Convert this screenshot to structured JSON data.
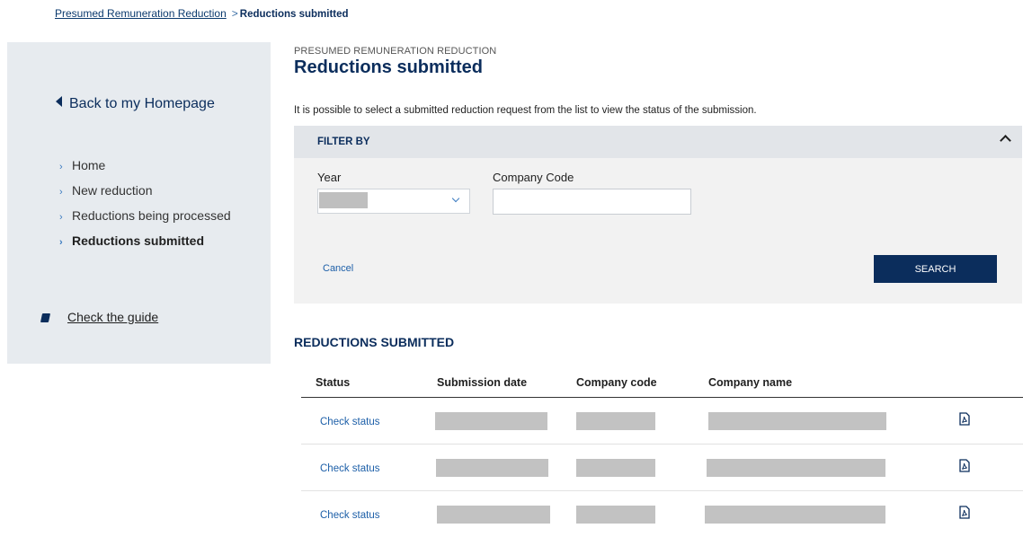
{
  "breadcrumb": {
    "parent": "Presumed Remuneration Reduction",
    "separator": ">",
    "current": "Reductions submitted"
  },
  "sidebar": {
    "back_label": "Back to my Homepage",
    "items": [
      {
        "label": "Home"
      },
      {
        "label": "New reduction"
      },
      {
        "label": "Reductions being processed"
      },
      {
        "label": "Reductions submitted",
        "active": true
      }
    ],
    "guide_label": "Check the guide"
  },
  "header": {
    "kicker": "PRESUMED REMUNERATION REDUCTION",
    "title": "Reductions submitted",
    "intro": "It is possible to select a submitted reduction request from the list to view the status of the submission."
  },
  "filter": {
    "title": "FILTER BY",
    "year_label": "Year",
    "year_value": "",
    "company_code_label": "Company Code",
    "company_code_value": "",
    "cancel_label": "Cancel",
    "search_label": "SEARCH"
  },
  "results": {
    "title": "REDUCTIONS SUBMITTED",
    "columns": [
      "Status",
      "Submission date",
      "Company code",
      "Company name"
    ],
    "rows": [
      {
        "status": "Check status",
        "submission_date": "",
        "company_code": "",
        "company_name": ""
      },
      {
        "status": "Check status",
        "submission_date": "",
        "company_code": "",
        "company_name": ""
      },
      {
        "status": "Check status",
        "submission_date": "",
        "company_code": "",
        "company_name": ""
      }
    ]
  },
  "colors": {
    "navy": "#0b2d5c",
    "link": "#1d5fa8",
    "sidebar_bg": "#e7ebef",
    "filter_bg": "#f2f2f2",
    "redacted": "#c2c2c2"
  },
  "icons": {
    "back": "triangle-left-icon",
    "nav": "chevron-right-icon",
    "guide": "book-icon",
    "filter_toggle": "chevron-up-icon",
    "select": "chevron-down-icon",
    "row_action": "pdf-icon"
  }
}
